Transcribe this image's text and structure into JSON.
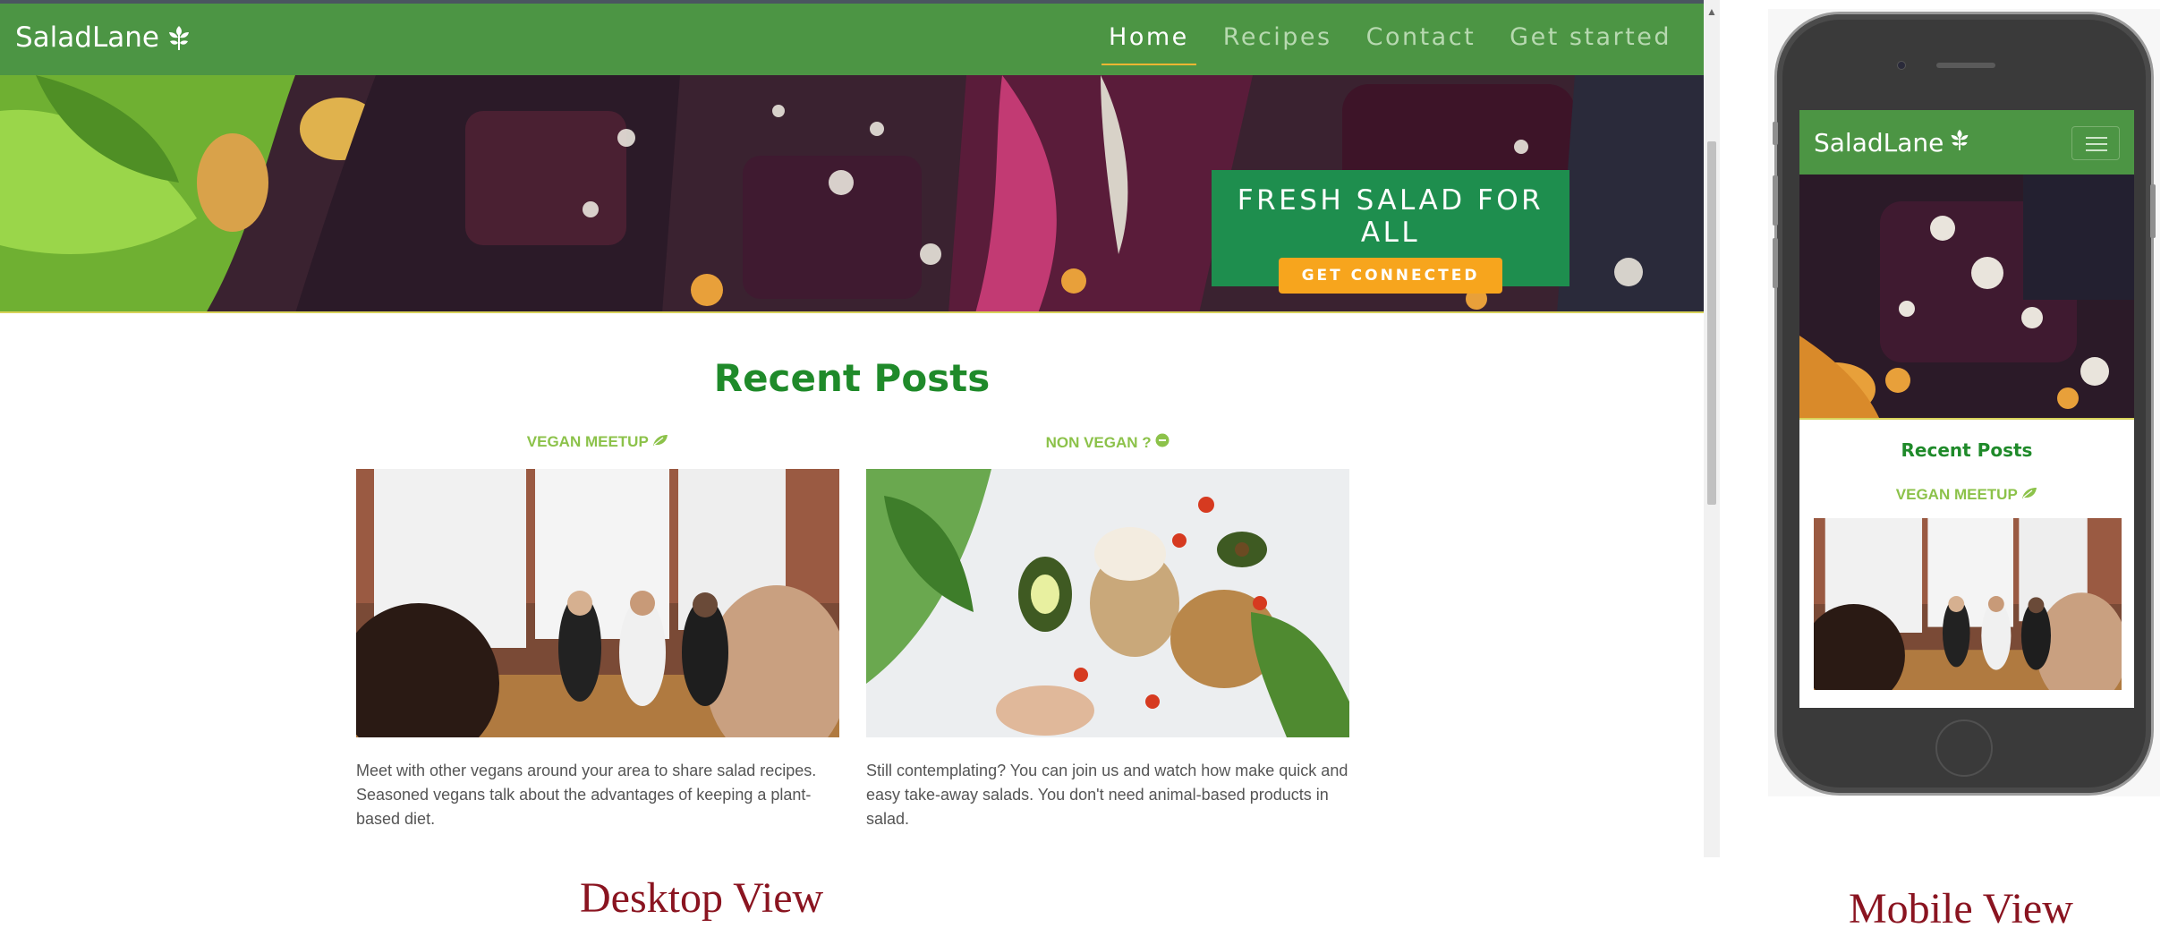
{
  "brand": {
    "name": "SaladLane",
    "icon": "leaf-icon"
  },
  "nav": {
    "items": [
      {
        "label": "Home",
        "active": true
      },
      {
        "label": "Recipes",
        "active": false
      },
      {
        "label": "Contact",
        "active": false
      },
      {
        "label": "Get started",
        "active": false
      }
    ]
  },
  "hero": {
    "title": "FRESH SALAD FOR ALL",
    "button_label": "GET CONNECTED"
  },
  "recent_posts": {
    "title": "Recent Posts",
    "posts": [
      {
        "category": "VEGAN MEETUP",
        "category_icon": "leaf-icon",
        "text": "Meet with other vegans around your area to share salad recipes. Seasoned vegans talk about the advantages of keeping a plant-based diet."
      },
      {
        "category": "NON VEGAN ?",
        "category_icon": "minus-circle-icon",
        "text": "Still contemplating? You can join us and watch how make quick and easy take-away salads. You don't need animal-based products in salad."
      }
    ]
  },
  "captions": {
    "desktop": "Desktop View",
    "mobile": "Mobile View"
  },
  "colors": {
    "nav_green": "#4c9544",
    "cta_green": "#1e8e4e",
    "cta_button": "#f7a51d",
    "heading_green": "#1f8a2a",
    "category_green": "#8cc24a",
    "caption_red": "#8a1420",
    "active_underline": "#f2b632"
  }
}
